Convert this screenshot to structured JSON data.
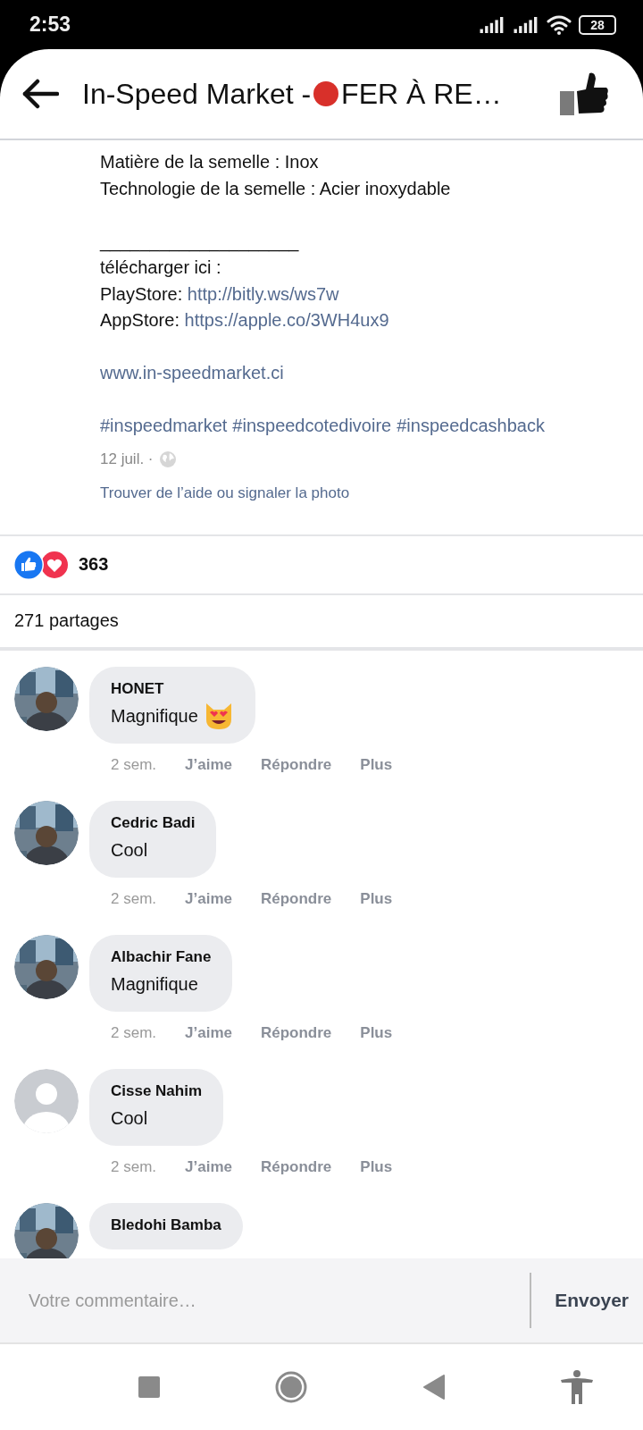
{
  "status_bar": {
    "time": "2:53",
    "battery": "28"
  },
  "header": {
    "title_start": "In-Speed Market - ",
    "title_end": "FER À RE…"
  },
  "post": {
    "lines": [
      {
        "kind": "text",
        "text": "Matière de la semelle : Inox"
      },
      {
        "kind": "text",
        "text": "Technologie de la semelle : Acier inoxydable"
      },
      {
        "kind": "blank"
      },
      {
        "kind": "text",
        "text": "____________________"
      },
      {
        "kind": "text",
        "text": "télécharger ici :"
      },
      {
        "kind": "link",
        "label": "PlayStore: ",
        "link": "http://bitly.ws/ws7w"
      },
      {
        "kind": "link",
        "label": "AppStore: ",
        "link": "https://apple.co/3WH4ux9"
      },
      {
        "kind": "blank"
      },
      {
        "kind": "link",
        "link": "www.in-speedmarket.ci"
      },
      {
        "kind": "blank"
      },
      {
        "kind": "tags",
        "tags": [
          "#inspeedmarket",
          "#inspeedcotedivoire",
          "#inspeedcashback"
        ]
      }
    ],
    "date": "12 juil. ·",
    "help_link": "Trouver de l’aide ou signaler la photo"
  },
  "reactions": {
    "count": "363"
  },
  "shares": "271 partages",
  "comments": [
    {
      "name": "HONET",
      "text": "Magnifique",
      "emoji": true,
      "time": "2 sem.",
      "actions": [
        "J’aime",
        "Répondre",
        "Plus"
      ]
    },
    {
      "name": "Cedric Badi",
      "text": "Cool",
      "time": "2 sem.",
      "actions": [
        "J’aime",
        "Répondre",
        "Plus"
      ]
    },
    {
      "name": "Albachir Fane",
      "text": "Magnifique",
      "time": "2 sem.",
      "actions": [
        "J’aime",
        "Répondre",
        "Plus"
      ]
    },
    {
      "kind": "default",
      "name": "Cisse Nahim",
      "text": "Cool",
      "time": "2 sem.",
      "actions": [
        "J’aime",
        "Répondre",
        "Plus"
      ]
    },
    {
      "name": "Bledohi Bamba"
    }
  ],
  "composer": {
    "placeholder": "Votre commentaire…",
    "send": "Envoyer"
  }
}
